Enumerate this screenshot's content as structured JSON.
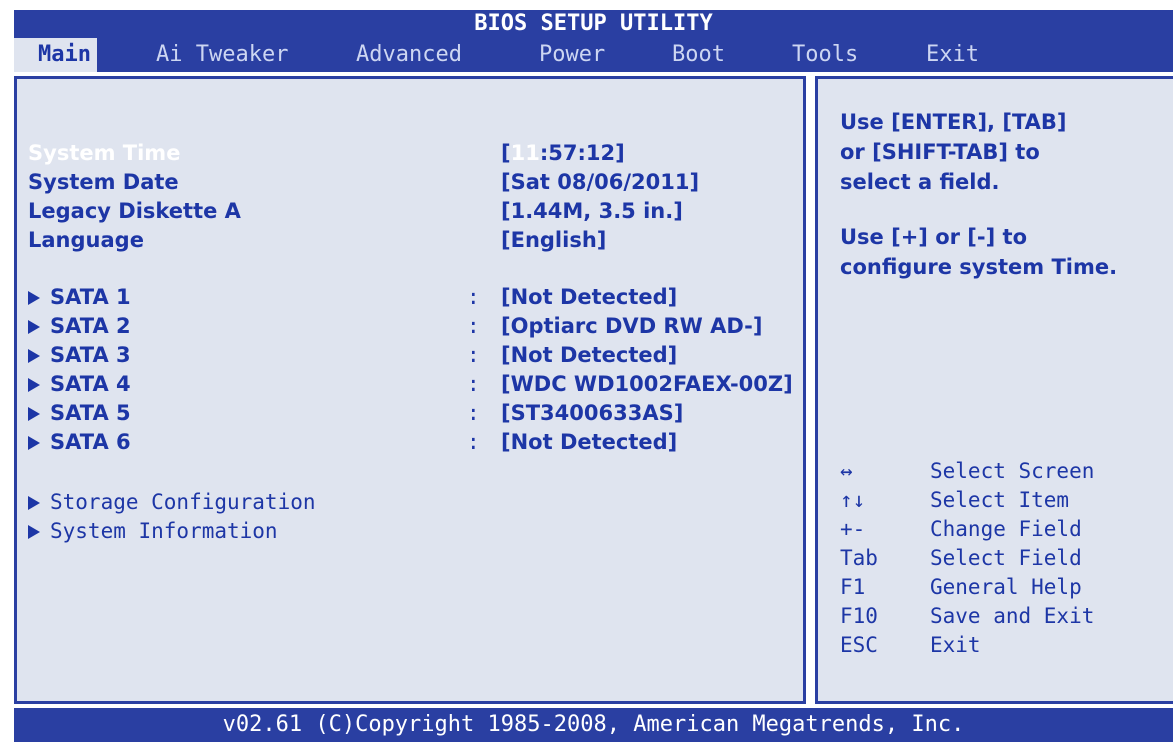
{
  "title": "BIOS SETUP UTILITY",
  "menu": [
    {
      "label": "Main",
      "active": true
    },
    {
      "label": "Ai Tweaker"
    },
    {
      "label": "Advanced"
    },
    {
      "label": "Power"
    },
    {
      "label": "Boot"
    },
    {
      "label": "Tools"
    },
    {
      "label": "Exit"
    }
  ],
  "settings": {
    "system_time_label": "System Time",
    "system_time_open": "[",
    "system_time_hour": "11",
    "system_time_rest": ":57:12]",
    "system_date_label": "System Date",
    "system_date_value": "[Sat 08/06/2011]",
    "diskette_label": "Legacy Diskette A",
    "diskette_value": "[1.44M, 3.5 in.]",
    "language_label": "Language",
    "language_value": "[English]"
  },
  "sata": [
    {
      "label": "SATA 1",
      "value": "[Not Detected]"
    },
    {
      "label": "SATA 2",
      "value": "[Optiarc DVD RW AD-]"
    },
    {
      "label": "SATA 3",
      "value": "[Not Detected]"
    },
    {
      "label": "SATA 4",
      "value": "[WDC WD1002FAEX-00Z]"
    },
    {
      "label": "SATA 5",
      "value": "[ST3400633AS]"
    },
    {
      "label": "SATA 6",
      "value": "[Not Detected]"
    }
  ],
  "colon": ":",
  "submenus": [
    {
      "label": "Storage Configuration"
    },
    {
      "label": "System Information"
    }
  ],
  "help": {
    "line1": "Use [ENTER], [TAB]",
    "line2": "or [SHIFT-TAB] to",
    "line3": "select a field.",
    "line4": "Use [+] or [-] to",
    "line5": "configure system Time."
  },
  "keys": [
    {
      "key": "↔",
      "desc": "Select Screen"
    },
    {
      "key": "↑↓",
      "desc": "Select Item"
    },
    {
      "key": "+-",
      "desc": "Change Field"
    },
    {
      "key": "Tab",
      "desc": "Select Field"
    },
    {
      "key": "F1",
      "desc": "General Help"
    },
    {
      "key": "F10",
      "desc": "Save and Exit"
    },
    {
      "key": "ESC",
      "desc": "Exit"
    }
  ],
  "footer": "v02.61 (C)Copyright 1985-2008, American Megatrends, Inc.",
  "colors": {
    "bar_blue": "#2a3fa2",
    "panel_bg": "#dfe4ef",
    "text_blue": "#1d36a6",
    "highlight": "#ffffff"
  }
}
